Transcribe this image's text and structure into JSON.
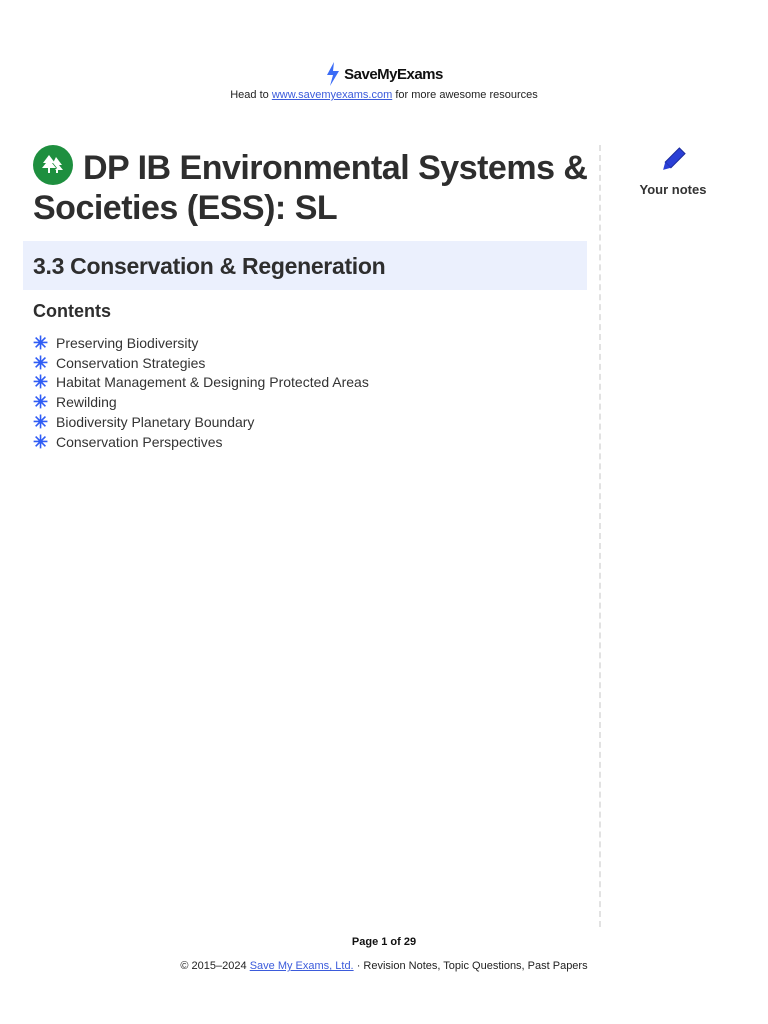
{
  "header": {
    "brand": "SaveMyExams",
    "prefix": "Head to",
    "link": "www.savemyexams.com",
    "suffix": "for more awesome resources"
  },
  "title": "DP IB Environmental Systems & Societies (ESS): SL",
  "section": "3.3 Conservation & Regeneration",
  "contents": {
    "heading": "Contents",
    "items": [
      "Preserving Biodiversity",
      "Conservation Strategies",
      "Habitat Management & Designing Protected Areas",
      "Rewilding",
      "Biodiversity Planetary Boundary",
      "Conservation Perspectives"
    ]
  },
  "notes_label": "Your notes",
  "footer": {
    "page": "Page 1 of 29",
    "copyright": "© 2015–2024",
    "link": "Save My Exams, Ltd.",
    "suffix": "· Revision Notes, Topic Questions, Past Papers"
  },
  "colors": {
    "accent": "#2f5cf5",
    "band": "#ebf0fd",
    "icon_green": "#1e8f3f"
  }
}
